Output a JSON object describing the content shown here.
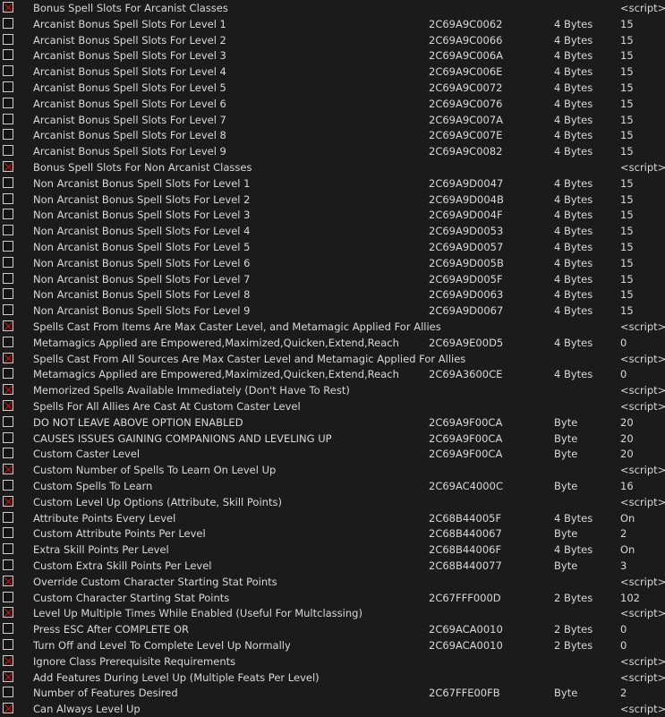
{
  "rows": [
    {
      "checked": true,
      "description": "Bonus Spell Slots For Arcanist Classes",
      "address": "",
      "type": "",
      "value": "<script>"
    },
    {
      "checked": false,
      "description": "Arcanist Bonus Spell Slots For Level 1",
      "address": "2C69A9C0062",
      "type": "4 Bytes",
      "value": "15"
    },
    {
      "checked": false,
      "description": "Arcanist Bonus Spell Slots For Level 2",
      "address": "2C69A9C0066",
      "type": "4 Bytes",
      "value": "15"
    },
    {
      "checked": false,
      "description": "Arcanist Bonus Spell Slots For Level 3",
      "address": "2C69A9C006A",
      "type": "4 Bytes",
      "value": "15"
    },
    {
      "checked": false,
      "description": "Arcanist Bonus Spell Slots For Level 4",
      "address": "2C69A9C006E",
      "type": "4 Bytes",
      "value": "15"
    },
    {
      "checked": false,
      "description": "Arcanist Bonus Spell Slots For Level 5",
      "address": "2C69A9C0072",
      "type": "4 Bytes",
      "value": "15"
    },
    {
      "checked": false,
      "description": "Arcanist Bonus Spell Slots For Level 6",
      "address": "2C69A9C0076",
      "type": "4 Bytes",
      "value": "15"
    },
    {
      "checked": false,
      "description": "Arcanist Bonus Spell Slots For Level 7",
      "address": "2C69A9C007A",
      "type": "4 Bytes",
      "value": "15"
    },
    {
      "checked": false,
      "description": "Arcanist Bonus Spell Slots For Level 8",
      "address": "2C69A9C007E",
      "type": "4 Bytes",
      "value": "15"
    },
    {
      "checked": false,
      "description": "Arcanist Bonus Spell Slots For Level 9",
      "address": "2C69A9C0082",
      "type": "4 Bytes",
      "value": "15"
    },
    {
      "checked": true,
      "description": "Bonus Spell Slots For Non Arcanist Classes",
      "address": "",
      "type": "",
      "value": "<script>"
    },
    {
      "checked": false,
      "description": "Non Arcanist Bonus Spell Slots For Level 1",
      "address": "2C69A9D0047",
      "type": "4 Bytes",
      "value": "15"
    },
    {
      "checked": false,
      "description": "Non Arcanist Bonus Spell Slots For Level 2",
      "address": "2C69A9D004B",
      "type": "4 Bytes",
      "value": "15"
    },
    {
      "checked": false,
      "description": "Non Arcanist Bonus Spell Slots For Level 3",
      "address": "2C69A9D004F",
      "type": "4 Bytes",
      "value": "15"
    },
    {
      "checked": false,
      "description": "Non Arcanist Bonus Spell Slots For Level 4",
      "address": "2C69A9D0053",
      "type": "4 Bytes",
      "value": "15"
    },
    {
      "checked": false,
      "description": "Non Arcanist Bonus Spell Slots For Level 5",
      "address": "2C69A9D0057",
      "type": "4 Bytes",
      "value": "15"
    },
    {
      "checked": false,
      "description": "Non Arcanist Bonus Spell Slots For Level 6",
      "address": "2C69A9D005B",
      "type": "4 Bytes",
      "value": "15"
    },
    {
      "checked": false,
      "description": "Non Arcanist Bonus Spell Slots For Level 7",
      "address": "2C69A9D005F",
      "type": "4 Bytes",
      "value": "15"
    },
    {
      "checked": false,
      "description": "Non Arcanist Bonus Spell Slots For Level 8",
      "address": "2C69A9D0063",
      "type": "4 Bytes",
      "value": "15"
    },
    {
      "checked": false,
      "description": "Non Arcanist Bonus Spell Slots For Level 9",
      "address": "2C69A9D0067",
      "type": "4 Bytes",
      "value": "15"
    },
    {
      "checked": true,
      "description": "Spells Cast From Items Are Max Caster Level, and Metamagic Applied For Allies",
      "address": "",
      "type": "",
      "value": "<script>"
    },
    {
      "checked": false,
      "description": "Metamagics Applied are Empowered,Maximized,Quicken,Extend,Reach",
      "address": "2C69A9E00D5",
      "type": "4 Bytes",
      "value": "0"
    },
    {
      "checked": true,
      "description": "Spells Cast From All Sources Are Max Caster Level and Metamagic Applied For Allies",
      "address": "",
      "type": "",
      "value": "<script>"
    },
    {
      "checked": false,
      "description": "Metamagics Applied are Empowered,Maximized,Quicken,Extend,Reach",
      "address": "2C69A3600CE",
      "type": "4 Bytes",
      "value": "0"
    },
    {
      "checked": true,
      "description": "Memorized Spells Available Immediately (Don't Have To Rest)",
      "address": "",
      "type": "",
      "value": "<script>"
    },
    {
      "checked": true,
      "description": "Spells For All Allies Are Cast At Custom Caster Level",
      "address": "",
      "type": "",
      "value": "<script>"
    },
    {
      "checked": false,
      "description": "DO NOT LEAVE ABOVE OPTION ENABLED",
      "address": "2C69A9F00CA",
      "type": "Byte",
      "value": "20"
    },
    {
      "checked": false,
      "description": "CAUSES ISSUES GAINING COMPANIONS AND LEVELING UP",
      "address": "2C69A9F00CA",
      "type": "Byte",
      "value": "20"
    },
    {
      "checked": false,
      "description": "Custom Caster Level",
      "address": "2C69A9F00CA",
      "type": "Byte",
      "value": "20"
    },
    {
      "checked": true,
      "description": "Custom Number of Spells To Learn On Level Up",
      "address": "",
      "type": "",
      "value": "<script>"
    },
    {
      "checked": false,
      "description": "Custom Spells To Learn",
      "address": "2C69AC4000C",
      "type": "Byte",
      "value": "16"
    },
    {
      "checked": true,
      "description": "Custom Level Up Options (Attribute, Skill Points)",
      "address": "",
      "type": "",
      "value": "<script>"
    },
    {
      "checked": false,
      "description": "Attribute Points Every Level",
      "address": "2C68B44005F",
      "type": "4 Bytes",
      "value": "On"
    },
    {
      "checked": false,
      "description": "Custom Attribute Points Per Level",
      "address": "2C68B440067",
      "type": "Byte",
      "value": "2"
    },
    {
      "checked": false,
      "description": "Extra Skill Points Per Level",
      "address": "2C68B44006F",
      "type": "4 Bytes",
      "value": "On"
    },
    {
      "checked": false,
      "description": "Custom Extra Skill Points Per Level",
      "address": "2C68B440077",
      "type": "Byte",
      "value": "3"
    },
    {
      "checked": true,
      "description": "Override Custom Character Starting Stat Points",
      "address": "",
      "type": "",
      "value": "<script>"
    },
    {
      "checked": false,
      "description": "Custom Character Starting Stat Points",
      "address": "2C67FFF000D",
      "type": "2 Bytes",
      "value": "102"
    },
    {
      "checked": true,
      "description": "Level Up Multiple Times While Enabled (Useful For Multclassing)",
      "address": "",
      "type": "",
      "value": "<script>"
    },
    {
      "checked": false,
      "description": "Press ESC After COMPLETE OR",
      "address": "2C69ACA0010",
      "type": "2 Bytes",
      "value": "0"
    },
    {
      "checked": false,
      "description": "Turn Off and Level To Complete Level Up Normally",
      "address": "2C69ACA0010",
      "type": "2 Bytes",
      "value": "0"
    },
    {
      "checked": true,
      "description": "Ignore Class Prerequisite Requirements",
      "address": "",
      "type": "",
      "value": "<script>"
    },
    {
      "checked": true,
      "description": "Add Features During Level Up (Multiple Feats Per Level)",
      "address": "",
      "type": "",
      "value": "<script>"
    },
    {
      "checked": false,
      "description": "Number of Features Desired",
      "address": "2C67FFE00FB",
      "type": "Byte",
      "value": "2"
    },
    {
      "checked": true,
      "description": "Can Always Level Up",
      "address": "",
      "type": "",
      "value": "<script>"
    }
  ]
}
